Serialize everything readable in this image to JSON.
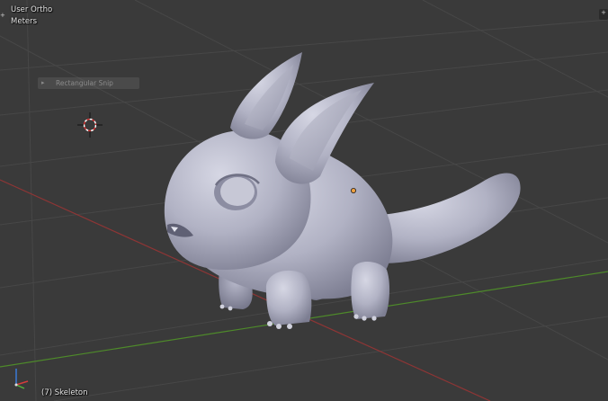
{
  "viewport": {
    "view_name": "User Ortho",
    "units": "Meters",
    "object_info": "(7) Skeleton",
    "last_operator": "Rectangular Snip"
  },
  "icons": [
    "3d-cursor-icon",
    "axis-gizmo-icon",
    "panel-toggle-icon",
    "collapse-triangle-icon"
  ],
  "colors": {
    "background": "#3a3a3a",
    "grid": "#474747",
    "x_axis": "#8e3535",
    "y_axis": "#4e8a2a",
    "mesh": "#b5b6c8",
    "text": "#e6e6e6",
    "origin_dot": "#f0a040"
  }
}
